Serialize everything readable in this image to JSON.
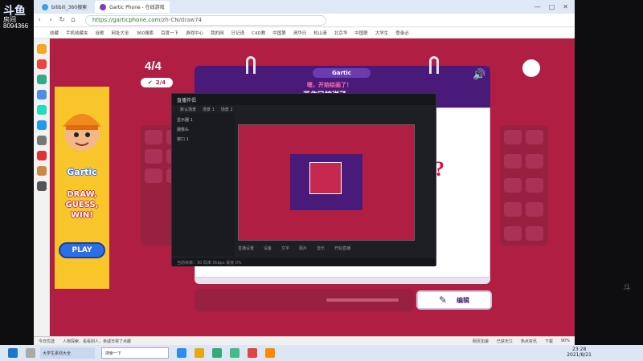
{
  "stream_logo": {
    "brand": "斗鱼",
    "sub": "房间",
    "room": "8094366"
  },
  "browser": {
    "tabs": [
      {
        "label": "bilibili_360搜索"
      },
      {
        "label": "Gartic Phone - 在线游戏"
      }
    ],
    "url_host": "https://garticphone.com",
    "url_path": "/zh-CN/draw74",
    "bookmarks": [
      "收藏",
      "手机收藏夹",
      "谷歌",
      "网址大全",
      "360搜索",
      "百度一下",
      "游戏中心",
      "我的网",
      "日记语",
      "C4D教",
      "中国第",
      "清华日",
      "松山清",
      "北京华",
      "中国联",
      "大学生",
      "登录必"
    ],
    "status_items": [
      "今日优选",
      "人物探索，看看别人，亲戚日常了点都",
      "网页加速",
      "已获天江",
      "热点资讯",
      "下载",
      "90%"
    ]
  },
  "game": {
    "round": "4/4",
    "players": "2/4",
    "logo": "Gartic",
    "prompt": "嗯，开始绘画了！",
    "prompt2": "画作已被送了",
    "question_mark": "?",
    "edit_button": "编辑"
  },
  "ad": {
    "title": "Gartic",
    "tagline1": "DRAW,",
    "tagline2": "GUESS,",
    "tagline3": "WIN!",
    "play": "PLAY"
  },
  "overlay": {
    "app_name": "直播伴侣",
    "tabs": [
      "默认场景",
      "场景 1",
      "场景 2"
    ],
    "scene_items": [
      "显示器 1",
      "摄像头",
      "窗口 1"
    ],
    "bottom_items": [
      "直播设置",
      "设备",
      "文字",
      "图片",
      "音乐",
      "开始直播"
    ],
    "status": "当前帧率：30 码率 0kbps 丢帧 0%"
  },
  "taskbar": {
    "search": "搜索一下",
    "app": "大学生素材大全",
    "time": "23:28",
    "date": "2021/8/21"
  }
}
